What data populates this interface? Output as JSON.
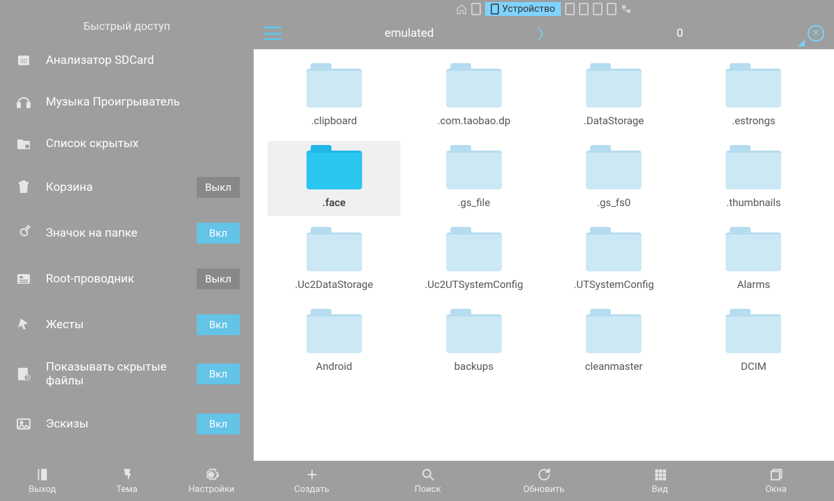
{
  "topbar": {
    "device_label": "Устройство"
  },
  "sidebar": {
    "title": "Быстрый доступ",
    "items": [
      {
        "label": "Анализатор SDCard",
        "toggle": null
      },
      {
        "label": "Музыка Проигрыватель",
        "toggle": null
      },
      {
        "label": "Список скрытых",
        "toggle": null
      },
      {
        "label": "Корзина",
        "toggle": "off"
      },
      {
        "label": "Значок на папке",
        "toggle": "on"
      },
      {
        "label": "Root-проводник",
        "toggle": "off"
      },
      {
        "label": "Жесты",
        "toggle": "on"
      },
      {
        "label": "Показывать скрытые файлы",
        "toggle": "on"
      },
      {
        "label": "Эскизы",
        "toggle": "on"
      }
    ],
    "toggle_on_label": "Вкл",
    "toggle_off_label": "Выкл"
  },
  "path": {
    "seg1": "emulated",
    "sep": "〉",
    "seg2": "0"
  },
  "folders": [
    {
      "name": ".clipboard",
      "selected": false
    },
    {
      "name": ".com.taobao.dp",
      "selected": false
    },
    {
      "name": ".DataStorage",
      "selected": false
    },
    {
      "name": ".estrongs",
      "selected": false
    },
    {
      "name": ".face",
      "selected": true
    },
    {
      "name": ".gs_file",
      "selected": false
    },
    {
      "name": ".gs_fs0",
      "selected": false
    },
    {
      "name": ".thumbnails",
      "selected": false
    },
    {
      "name": ".Uc2DataStorage",
      "selected": false
    },
    {
      "name": ".Uc2UTSystemConfig",
      "selected": false
    },
    {
      "name": ".UTSystemConfig",
      "selected": false
    },
    {
      "name": "Alarms",
      "selected": false
    },
    {
      "name": "Android",
      "selected": false
    },
    {
      "name": "backups",
      "selected": false
    },
    {
      "name": "cleanmaster",
      "selected": false
    },
    {
      "name": "DCIM",
      "selected": false
    }
  ],
  "bottom_left": [
    {
      "label": "Выход"
    },
    {
      "label": "Тема"
    },
    {
      "label": "Настройки"
    }
  ],
  "bottom_right": [
    {
      "label": "Создать"
    },
    {
      "label": "Поиск"
    },
    {
      "label": "Обновить"
    },
    {
      "label": "Вид"
    },
    {
      "label": "Окна"
    }
  ]
}
